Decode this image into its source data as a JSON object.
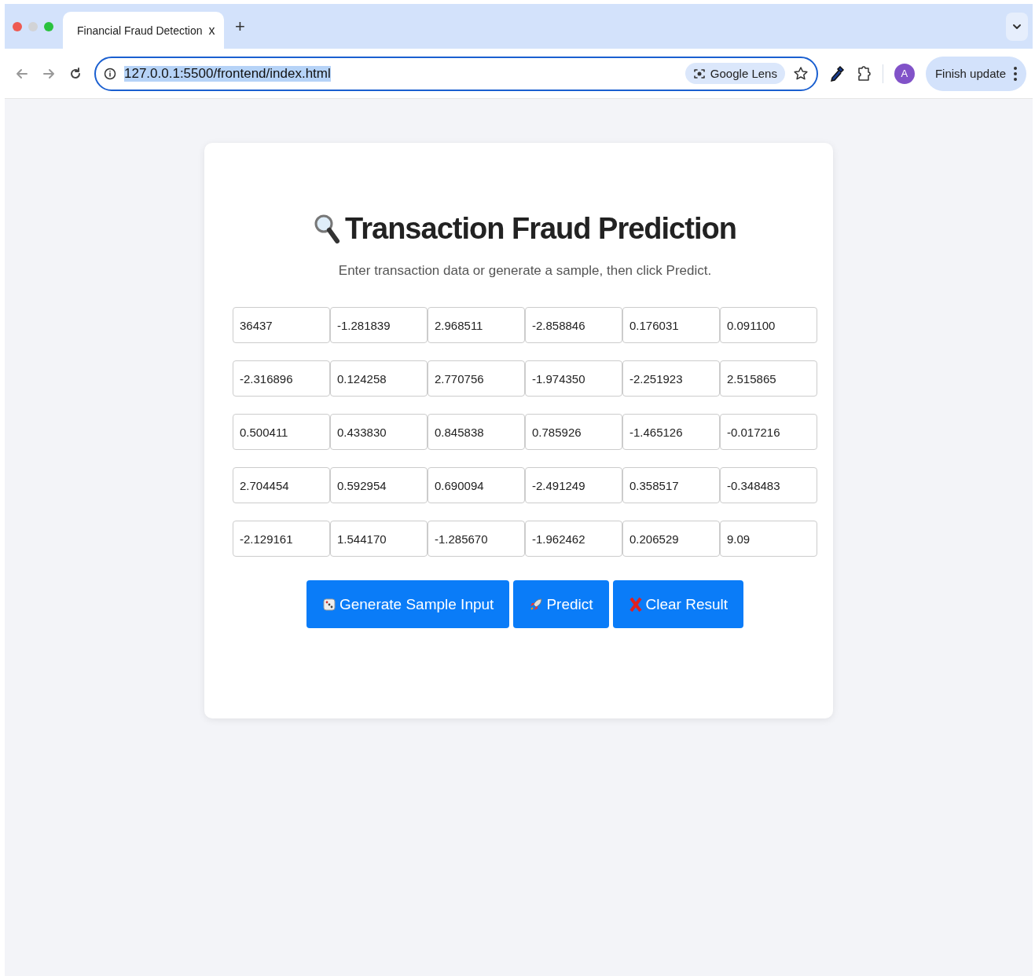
{
  "browser": {
    "tab": {
      "title": "Financial Fraud Detection",
      "close": "x",
      "selected": true
    },
    "new_tab": "+",
    "address": "127.0.0.1:5500/frontend/index.html",
    "lens": "Google Lens",
    "profile": "A",
    "update": "Finish update"
  },
  "page": {
    "title": "Transaction Fraud Prediction",
    "subtitle": "Enter transaction data or generate a sample, then click Predict.",
    "inputs": [
      [
        "36437",
        "-1.281839",
        "2.968511",
        "-2.858846",
        "0.176031",
        "0.091100"
      ],
      [
        "-2.316896",
        "0.124258",
        "2.770756",
        "-1.974350",
        "-2.251923",
        "2.515865"
      ],
      [
        "0.500411",
        "0.433830",
        "0.845838",
        "0.785926",
        "-1.465126",
        "-0.017216"
      ],
      [
        "2.704454",
        "0.592954",
        "0.690094",
        "-2.491249",
        "0.358517",
        "-0.348483"
      ],
      [
        "-2.129161",
        "1.544170",
        "-1.285670",
        "-1.962462",
        "0.206529",
        "9.09"
      ]
    ],
    "buttons": [
      {
        "kind": "dice",
        "label": "Generate Sample Input"
      },
      {
        "kind": "rocket",
        "label": "Predict"
      },
      {
        "kind": "cross",
        "label": "Clear Result"
      }
    ]
  }
}
